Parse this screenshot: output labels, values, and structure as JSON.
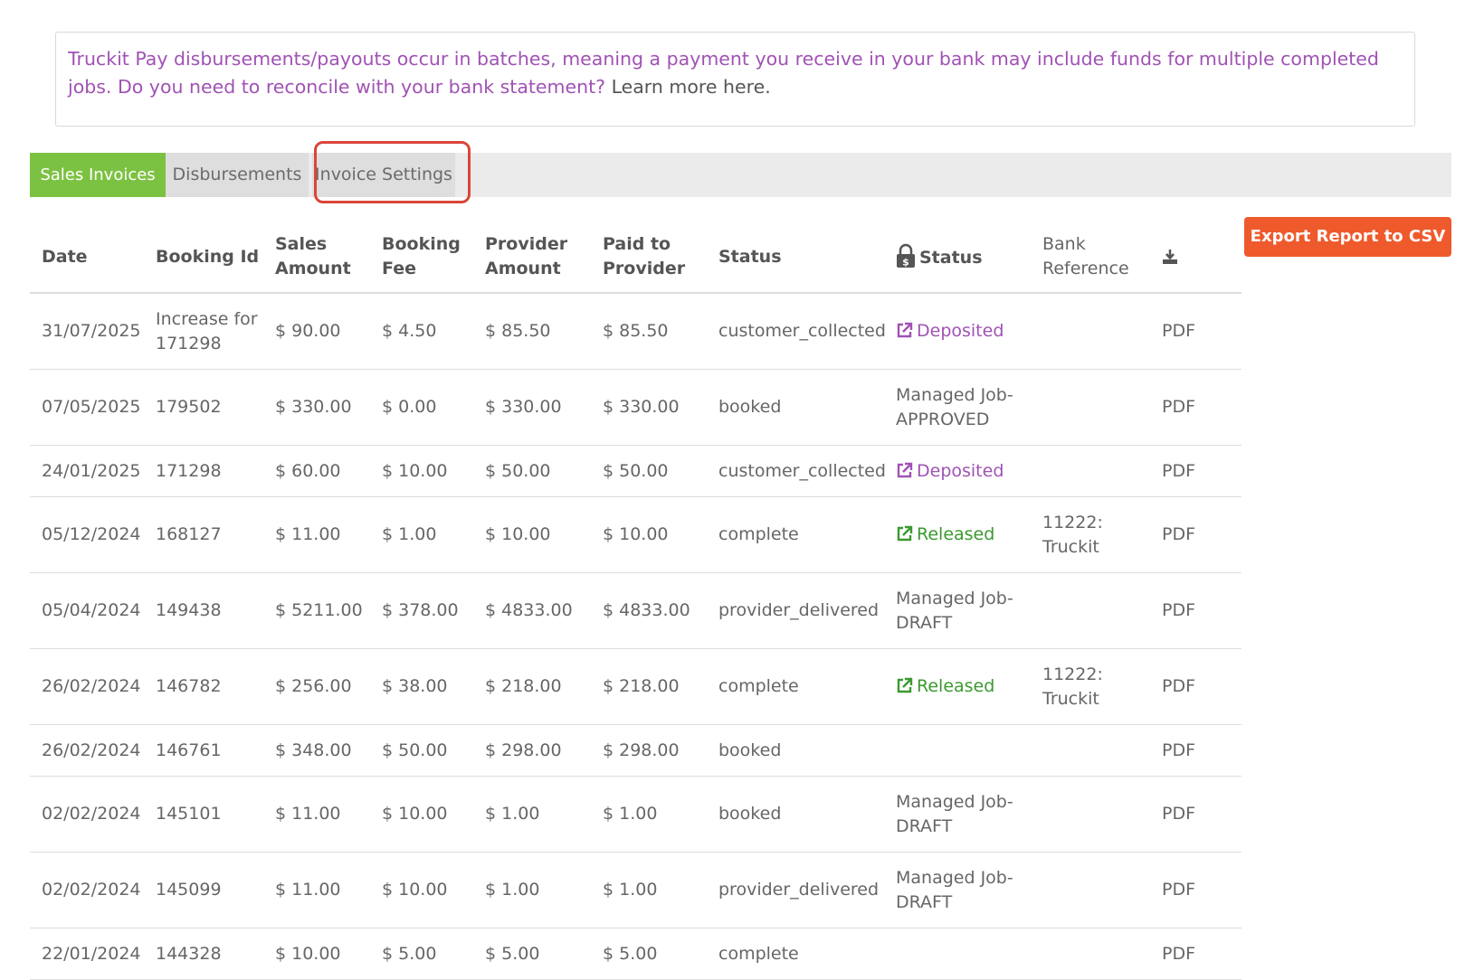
{
  "notice": {
    "text": "Truckit Pay disbursements/payouts occur in batches, meaning a payment you receive in your bank may include funds for multiple completed jobs.  Do you need to reconcile with your bank statement?",
    "learn_more": "Learn more here."
  },
  "tabs": {
    "sales": "Sales Invoices",
    "disbursements": "Disbursements",
    "settings": "Invoice Settings"
  },
  "export_label": "Export Report to CSV",
  "headers": {
    "date": "Date",
    "booking_id": "Booking Id",
    "sales_amount": "Sales Amount",
    "booking_fee": "Booking Fee",
    "provider_amount": "Provider Amount",
    "paid_to_provider": "Paid to Provider",
    "status": "Status",
    "pay_status": "Status",
    "bank_reference": "Bank Reference"
  },
  "rows": [
    {
      "date": "31/07/2025",
      "booking": "Increase for 171298",
      "sales": "$ 90.00",
      "fee": "$ 4.50",
      "provider": "$ 85.50",
      "paid": "$ 85.50",
      "status": "customer_collected",
      "pay_status": "Deposited",
      "bank_ref": "",
      "pdf": "PDF"
    },
    {
      "date": "07/05/2025",
      "booking": "179502",
      "sales": "$ 330.00",
      "fee": "$ 0.00",
      "provider": "$ 330.00",
      "paid": "$ 330.00",
      "status": "booked",
      "pay_status": "Managed Job-APPROVED",
      "bank_ref": "",
      "pdf": "PDF"
    },
    {
      "date": "24/01/2025",
      "booking": "171298",
      "sales": "$ 60.00",
      "fee": "$ 10.00",
      "provider": "$ 50.00",
      "paid": "$ 50.00",
      "status": "customer_collected",
      "pay_status": "Deposited",
      "bank_ref": "",
      "pdf": "PDF"
    },
    {
      "date": "05/12/2024",
      "booking": "168127",
      "sales": "$ 11.00",
      "fee": "$ 1.00",
      "provider": "$ 10.00",
      "paid": "$ 10.00",
      "status": "complete",
      "pay_status": "Released",
      "bank_ref": "11222: Truckit",
      "pdf": "PDF"
    },
    {
      "date": "05/04/2024",
      "booking": "149438",
      "sales": "$ 5211.00",
      "fee": "$ 378.00",
      "provider": "$ 4833.00",
      "paid": "$ 4833.00",
      "status": "provider_delivered",
      "pay_status": "Managed Job-DRAFT",
      "bank_ref": "",
      "pdf": "PDF"
    },
    {
      "date": "26/02/2024",
      "booking": "146782",
      "sales": "$ 256.00",
      "fee": "$ 38.00",
      "provider": "$ 218.00",
      "paid": "$ 218.00",
      "status": "complete",
      "pay_status": "Released",
      "bank_ref": "11222: Truckit",
      "pdf": "PDF"
    },
    {
      "date": "26/02/2024",
      "booking": "146761",
      "sales": "$ 348.00",
      "fee": "$ 50.00",
      "provider": "$ 298.00",
      "paid": "$ 298.00",
      "status": "booked",
      "pay_status": "",
      "bank_ref": "",
      "pdf": "PDF"
    },
    {
      "date": "02/02/2024",
      "booking": "145101",
      "sales": "$ 11.00",
      "fee": "$ 10.00",
      "provider": "$ 1.00",
      "paid": "$ 1.00",
      "status": "booked",
      "pay_status": "Managed Job-DRAFT",
      "bank_ref": "",
      "pdf": "PDF"
    },
    {
      "date": "02/02/2024",
      "booking": "145099",
      "sales": "$ 11.00",
      "fee": "$ 10.00",
      "provider": "$ 1.00",
      "paid": "$ 1.00",
      "status": "provider_delivered",
      "pay_status": "Managed Job-DRAFT",
      "bank_ref": "",
      "pdf": "PDF"
    },
    {
      "date": "22/01/2024",
      "booking": "144328",
      "sales": "$ 10.00",
      "fee": "$ 5.00",
      "provider": "$ 5.00",
      "paid": "$ 5.00",
      "status": "complete",
      "pay_status": "",
      "bank_ref": "",
      "pdf": "PDF"
    }
  ],
  "colors": {
    "accent_green": "#7cc242",
    "export_orange": "#ef5a2c",
    "deposited_purple": "#a052b4",
    "released_green": "#3a9a2e",
    "highlight_red": "#d9463a"
  },
  "icons": {
    "lock": "padlock-dollar-icon",
    "download": "download-icon",
    "external": "external-link-icon"
  }
}
